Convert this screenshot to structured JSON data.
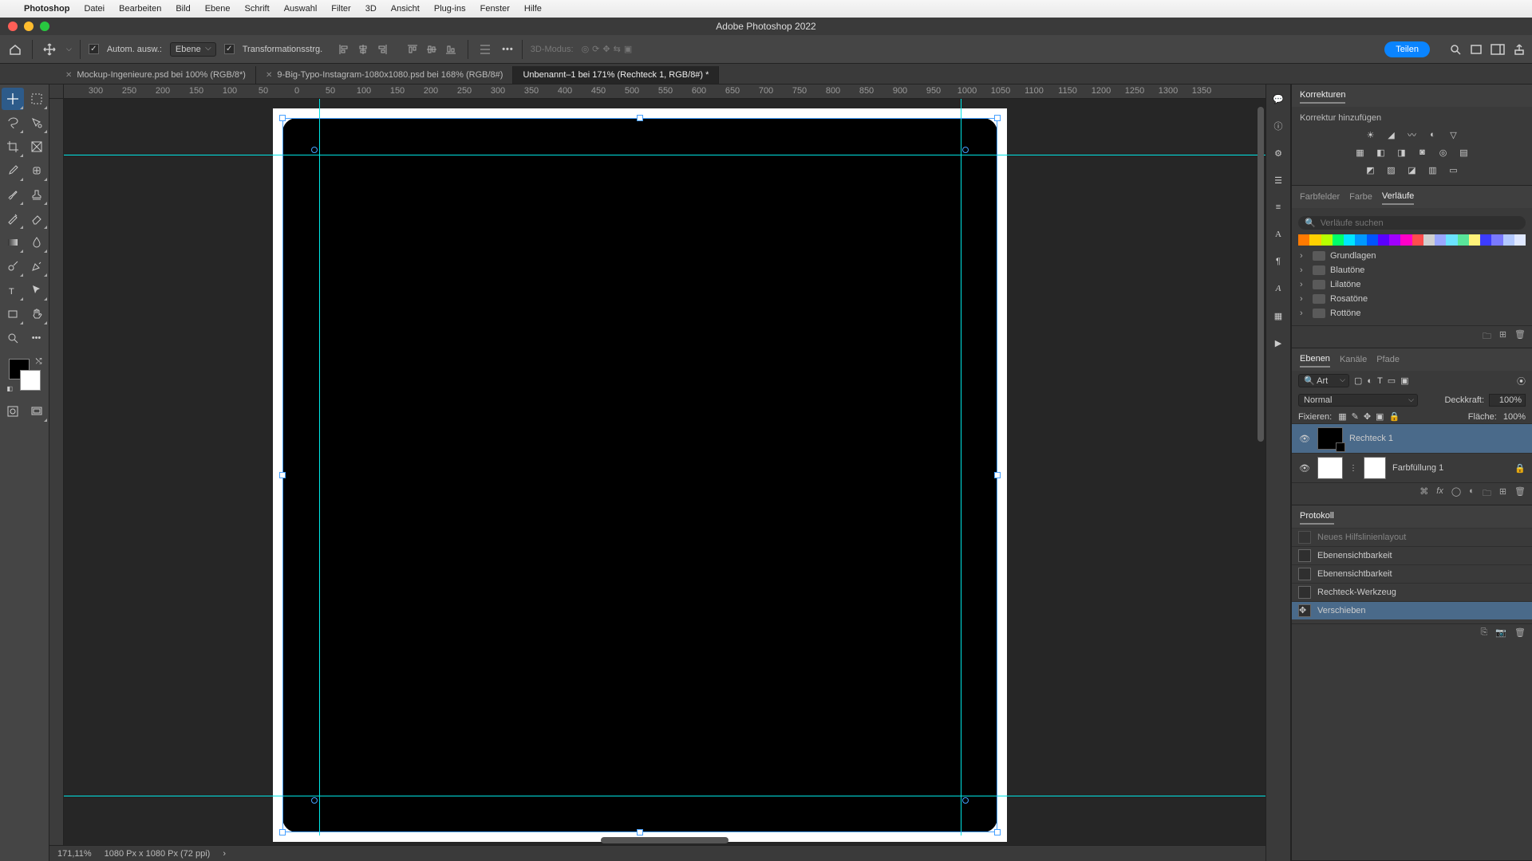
{
  "menubar": {
    "app": "Photoshop",
    "items": [
      "Datei",
      "Bearbeiten",
      "Bild",
      "Ebene",
      "Schrift",
      "Auswahl",
      "Filter",
      "3D",
      "Ansicht",
      "Plug-ins",
      "Fenster",
      "Hilfe"
    ]
  },
  "window_title": "Adobe Photoshop 2022",
  "options": {
    "auto_select_label": "Autom. ausw.:",
    "auto_select_value": "Ebene",
    "transform_controls": "Transformationsstrg.",
    "mode3d": "3D-Modus:",
    "teilen": "Teilen"
  },
  "tabs": [
    {
      "label": "Mockup-Ingenieure.psd bei 100% (RGB/8*)",
      "active": false
    },
    {
      "label": "9-Big-Typo-Instagram-1080x1080.psd bei 168% (RGB/8#)",
      "active": false
    },
    {
      "label": "Unbenannt–1 bei 171% (Rechteck 1, RGB/8#) *",
      "active": true
    }
  ],
  "ruler_ticks": [
    "300",
    "250",
    "200",
    "150",
    "100",
    "50",
    "0",
    "50",
    "100",
    "150",
    "200",
    "250",
    "300",
    "350",
    "400",
    "450",
    "500",
    "550",
    "600",
    "650",
    "700",
    "750",
    "800",
    "850",
    "900",
    "950",
    "1000",
    "1050",
    "1100",
    "1150",
    "1200",
    "1250",
    "1300",
    "1350"
  ],
  "status": {
    "zoom": "171,11%",
    "docinfo": "1080 Px x 1080 Px (72 ppi)",
    "more": "›"
  },
  "adjustments": {
    "title": "Korrekturen",
    "hint": "Korrektur hinzufügen"
  },
  "gradients": {
    "tabs": [
      "Farbfelder",
      "Farbe",
      "Verläufe"
    ],
    "search_placeholder": "Verläufe suchen",
    "folders": [
      "Grundlagen",
      "Blautöne",
      "Lilatöne",
      "Rosatöne",
      "Rottöne"
    ],
    "strip_colors": [
      "#ff7a00",
      "#ffd000",
      "#b8ff00",
      "#00ff6a",
      "#00e5ff",
      "#0099ff",
      "#0055ff",
      "#5a00ff",
      "#a000ff",
      "#ff00c8",
      "#ff4d4d",
      "#d0d0d0",
      "#9aa7ff",
      "#6be3ff",
      "#59e59a",
      "#fff27a",
      "#3c3cff",
      "#7a7aff",
      "#b3c9ff",
      "#dfe8ff"
    ]
  },
  "layers_panel": {
    "tabs": [
      "Ebenen",
      "Kanäle",
      "Pfade"
    ],
    "filter_label": "Art",
    "blend_mode": "Normal",
    "opacity_label": "Deckkraft:",
    "opacity_value": "100%",
    "lock_label": "Fixieren:",
    "fill_label": "Fläche:",
    "fill_value": "100%",
    "layers": [
      {
        "name": "Rechteck 1",
        "selected": true,
        "locked": false,
        "kind": "shape"
      },
      {
        "name": "Farbfüllung 1",
        "selected": false,
        "locked": true,
        "kind": "fill"
      }
    ]
  },
  "history": {
    "title": "Protokoll",
    "rows": [
      "Neues Hilfslinienlayout",
      "Ebenensichtbarkeit",
      "Ebenensichtbarkeit",
      "Rechteck-Werkzeug",
      "Verschieben"
    ]
  }
}
